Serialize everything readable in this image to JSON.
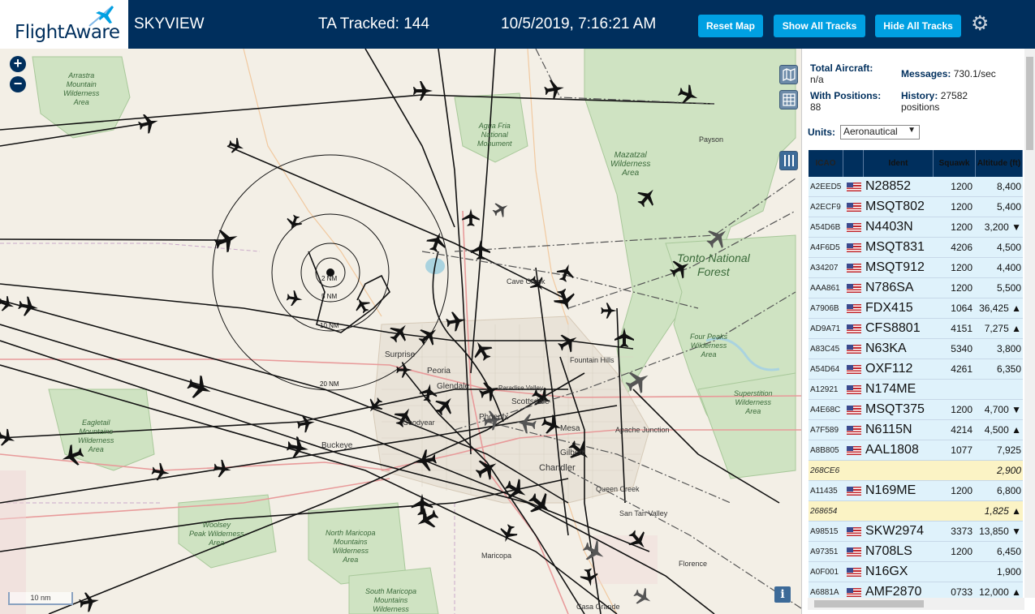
{
  "header": {
    "logo_text": "FlightAware",
    "site_name": "SKYVIEW",
    "ta_tracked": "TA Tracked: 144",
    "datetime": "10/5/2019, 7:16:21 AM",
    "btn_reset": "Reset Map",
    "btn_show": "Show All Tracks",
    "btn_hide": "Hide All Tracks"
  },
  "map": {
    "zoom_in": "+",
    "zoom_out": "−",
    "scale_label": "10 nm",
    "info": "i",
    "range_labels": [
      "2 NM",
      "5 NM",
      "10 NM",
      "20 NM"
    ],
    "area_labels": {
      "arrastra": "Arrastra\nMountain\nWilderness\nArea",
      "agua_fria": "Agua Fria\nNational\nMonument",
      "mazatzal": "Mazatzal\nWilderness\nArea",
      "tonto": "Tonto National\nForest",
      "four_peaks": "Four Peaks\nWilderness\nArea",
      "superstition": "Superstition\nWilderness\nArea",
      "eagletail": "Eagletail\nMountains\nWilderness\nArea",
      "woolsey": "Woolsey\nPeak Wilderness\nArea",
      "north_maricopa": "North Maricopa\nMountains\nWilderness\nArea",
      "south_maricopa": "South Maricopa\nMountains\nWilderness"
    },
    "city_labels": {
      "payson": "Payson",
      "cave_creek": "Cave Creek",
      "fountain_hills": "Fountain Hills",
      "surprise": "Surprise",
      "peoria": "Peoria",
      "glendale": "Glendale",
      "paradise_valley": "Paradise Valley",
      "scottsdale": "Scottsdale",
      "goodyear": "Goodyear",
      "phoenix": "Phoenix",
      "mesa": "Mesa",
      "gilbert": "Gilbert",
      "apache_junction": "Apache Junction",
      "buckeye": "Buckeye",
      "chandler": "Chandler",
      "queen_creek": "Queen Creek",
      "san_tan_valley": "San Tan Valley",
      "maricopa": "Maricopa",
      "florence": "Florence",
      "casa_grande": "Casa Grande"
    }
  },
  "stats": {
    "total_aircraft_label": "Total Aircraft:",
    "total_aircraft_value": "n/a",
    "messages_label": "Messages:",
    "messages_value": "730.1/sec",
    "with_positions_label": "With Positions:",
    "with_positions_value": "88",
    "history_label": "History:",
    "history_value": "27582",
    "history_unit": "positions",
    "units_label": "Units:",
    "units_value": "Aeronautical"
  },
  "table": {
    "headers": {
      "icao": "ICAO",
      "ident": "Ident",
      "squawk": "Squawk",
      "altitude": "Altitude (ft)"
    },
    "rows": [
      {
        "icao": "A2EED5",
        "flag": true,
        "ident": "N28852",
        "squawk": "1200",
        "altitude": "8,400",
        "alt": false
      },
      {
        "icao": "A2ECF9",
        "flag": true,
        "ident": "MSQT802",
        "squawk": "1200",
        "altitude": "5,400",
        "alt": false
      },
      {
        "icao": "A54D6B",
        "flag": true,
        "ident": "N4403N",
        "squawk": "1200",
        "altitude": "3,200 ▼",
        "alt": false
      },
      {
        "icao": "A4F6D5",
        "flag": true,
        "ident": "MSQT831",
        "squawk": "4206",
        "altitude": "4,500",
        "alt": false
      },
      {
        "icao": "A34207",
        "flag": true,
        "ident": "MSQT912",
        "squawk": "1200",
        "altitude": "4,400",
        "alt": false
      },
      {
        "icao": "AAA861",
        "flag": true,
        "ident": "N786SA",
        "squawk": "1200",
        "altitude": "5,500",
        "alt": false
      },
      {
        "icao": "A7906B",
        "flag": true,
        "ident": "FDX415",
        "squawk": "1064",
        "altitude": "36,425 ▲",
        "alt": false
      },
      {
        "icao": "AD9A71",
        "flag": true,
        "ident": "CFS8801",
        "squawk": "4151",
        "altitude": "7,275 ▲",
        "alt": false
      },
      {
        "icao": "A83C45",
        "flag": true,
        "ident": "N63KA",
        "squawk": "5340",
        "altitude": "3,800",
        "alt": false
      },
      {
        "icao": "A54D64",
        "flag": true,
        "ident": "OXF112",
        "squawk": "4261",
        "altitude": "6,350",
        "alt": false
      },
      {
        "icao": "A12921",
        "flag": true,
        "ident": "N174ME",
        "squawk": "",
        "altitude": "",
        "alt": false
      },
      {
        "icao": "A4E68C",
        "flag": true,
        "ident": "MSQT375",
        "squawk": "1200",
        "altitude": "4,700 ▼",
        "alt": false
      },
      {
        "icao": "A7F589",
        "flag": true,
        "ident": "N6115N",
        "squawk": "4214",
        "altitude": "4,500 ▲",
        "alt": false
      },
      {
        "icao": "A8B805",
        "flag": true,
        "ident": "AAL1808",
        "squawk": "1077",
        "altitude": "7,925",
        "alt": false
      },
      {
        "icao": "268CE6",
        "flag": false,
        "ident": "",
        "squawk": "",
        "altitude": "2,900",
        "alt": true
      },
      {
        "icao": "A11435",
        "flag": true,
        "ident": "N169ME",
        "squawk": "1200",
        "altitude": "6,800",
        "alt": false
      },
      {
        "icao": "268654",
        "flag": false,
        "ident": "",
        "squawk": "",
        "altitude": "1,825 ▲",
        "alt": true
      },
      {
        "icao": "A98515",
        "flag": true,
        "ident": "SKW2974",
        "squawk": "3373",
        "altitude": "13,850 ▼",
        "alt": false
      },
      {
        "icao": "A97351",
        "flag": true,
        "ident": "N708LS",
        "squawk": "1200",
        "altitude": "6,450",
        "alt": false
      },
      {
        "icao": "A0F001",
        "flag": true,
        "ident": "N16GX",
        "squawk": "",
        "altitude": "1,900",
        "alt": false
      },
      {
        "icao": "A6881A",
        "flag": true,
        "ident": "AMF2870",
        "squawk": "0733",
        "altitude": "12,000 ▲",
        "alt": false
      }
    ]
  }
}
